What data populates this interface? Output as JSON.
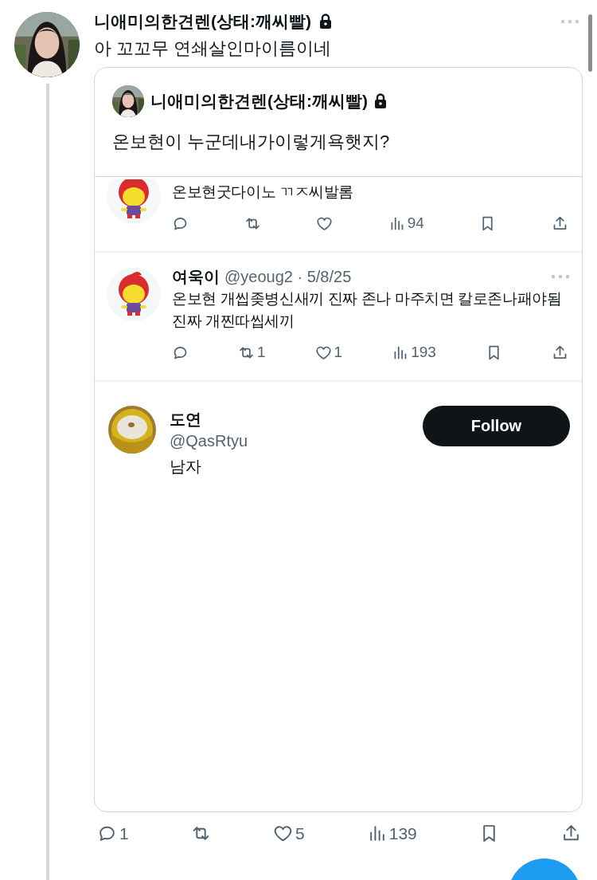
{
  "post": {
    "author": {
      "name": "니애미의한견렌(상태:깨씨빨)",
      "locked": true
    },
    "text": "아 꼬꼬무 연쇄살인마이름이네",
    "quote": {
      "author": {
        "name": "니애미의한견렌(상태:깨씨빨)",
        "locked": true
      },
      "text": "온보현이 누군데내가이렇게욕햇지?",
      "screenshot": {
        "tweets": [
          {
            "header_cut": true,
            "text": "온보현굿다이노 ㄲㅈ씨발롬",
            "actions": [
              {
                "kind": "reply"
              },
              {
                "kind": "repost"
              },
              {
                "kind": "like"
              },
              {
                "kind": "views",
                "count": "94"
              },
              {
                "kind": "bookmark"
              },
              {
                "kind": "share"
              }
            ]
          },
          {
            "header_cut": false,
            "name": "여욱이",
            "meta": "@yeoug2 · 5/8/25",
            "text": "온보현 개씹좆병신새끼 진짜 존나 마주치면 칼로존나패야됨 진짜 개찐따씹세끼",
            "actions": [
              {
                "kind": "reply"
              },
              {
                "kind": "repost",
                "count": "1"
              },
              {
                "kind": "like",
                "count": "1"
              },
              {
                "kind": "views",
                "count": "193"
              },
              {
                "kind": "bookmark"
              },
              {
                "kind": "share"
              }
            ]
          }
        ],
        "profile": {
          "name": "도연",
          "handle": "@QasRtyu",
          "bio": "남자",
          "button": "Follow"
        }
      }
    },
    "actions": [
      {
        "kind": "reply",
        "count": "1"
      },
      {
        "kind": "repost"
      },
      {
        "kind": "like",
        "count": "5"
      },
      {
        "kind": "views",
        "count": "139"
      },
      {
        "kind": "bookmark"
      },
      {
        "kind": "share"
      }
    ]
  }
}
